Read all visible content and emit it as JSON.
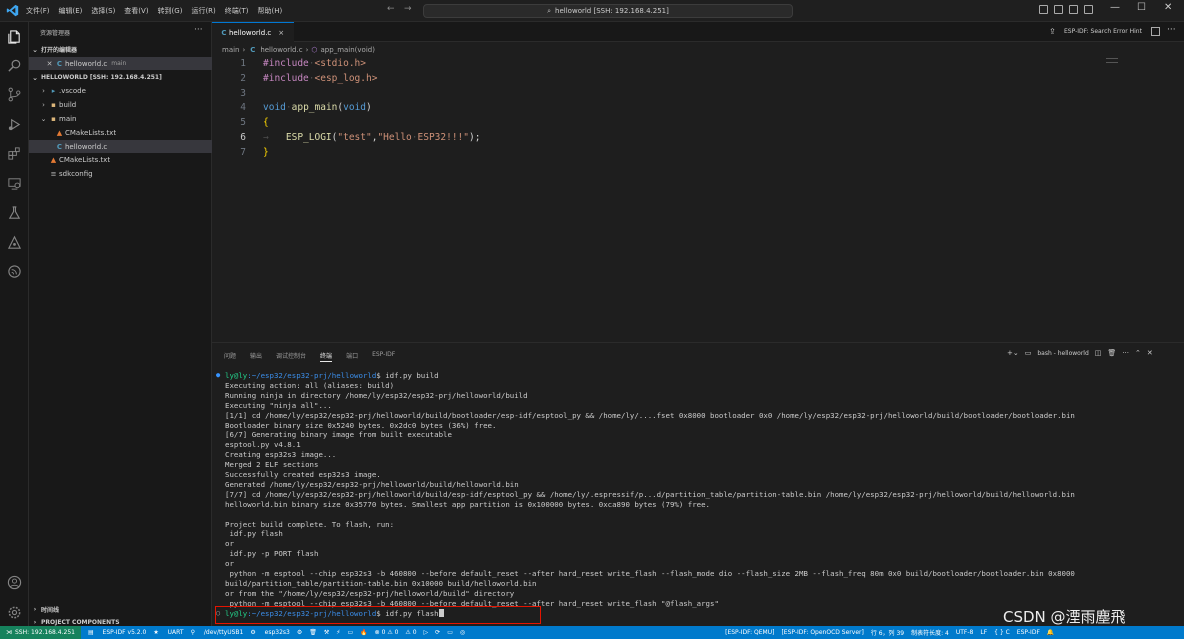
{
  "menu": [
    "文件(F)",
    "编辑(E)",
    "选择(S)",
    "查看(V)",
    "转到(G)",
    "运行(R)",
    "终端(T)",
    "帮助(H)"
  ],
  "search": {
    "text": "helloworld [SSH: 192.168.4.251]"
  },
  "window_controls": {
    "minimize": "—",
    "maximize": "☐",
    "close": "✕"
  },
  "sidebar": {
    "title": "资源管理器",
    "more": "···",
    "open_editors_label": "打开的编辑器",
    "open_editor": {
      "name": "helloworld.c",
      "tag": "main"
    },
    "workspace_label": "HELLOWORLD [SSH: 192.168.4.251]",
    "tree": [
      {
        "name": ".vscode",
        "kind": "folder"
      },
      {
        "name": "build",
        "kind": "folder"
      },
      {
        "name": "main",
        "kind": "folder-open"
      },
      {
        "name": "CMakeLists.txt",
        "kind": "cmake"
      },
      {
        "name": "helloworld.c",
        "kind": "c"
      },
      {
        "name": "CMakeLists.txt",
        "kind": "cmake"
      },
      {
        "name": "sdkconfig",
        "kind": "config"
      }
    ],
    "outline_label": "时间线",
    "components_label": "PROJECT COMPONENTS"
  },
  "tab": {
    "name": "helloworld.c",
    "close": "×"
  },
  "hint": "ESP-IDF: Search Error Hint",
  "breadcrumb": [
    "main",
    "helloworld.c",
    "app_main(void)"
  ],
  "code": {
    "line_numbers": [
      "1",
      "2",
      "3",
      "4",
      "5",
      "6",
      "7"
    ],
    "current_line": 6
  },
  "panel": {
    "tabs": [
      "问题",
      "输出",
      "调试控制台",
      "终端",
      "端口",
      "ESP-IDF"
    ],
    "active_tab": "终端",
    "shell": "bash - helloworld"
  },
  "terminal": {
    "prompt1_user": "ly@ly",
    "prompt1_path": ":~/esp32/esp32-prj/helloworld",
    "prompt1_cmd": "$ idf.py build",
    "lines": [
      "Executing action: all (aliases: build)",
      "Running ninja in directory /home/ly/esp32/esp32-prj/helloworld/build",
      "Executing \"ninja all\"...",
      "[1/1] cd /home/ly/esp32/esp32-prj/helloworld/build/bootloader/esp-idf/esptool_py && /home/ly/....fset 0x8000 bootloader 0x0 /home/ly/esp32/esp32-prj/helloworld/build/bootloader/bootloader.bin",
      "Bootloader binary size 0x5240 bytes. 0x2dc0 bytes (36%) free.",
      "[6/7] Generating binary image from built executable",
      "esptool.py v4.8.1",
      "Creating esp32s3 image...",
      "Merged 2 ELF sections",
      "Successfully created esp32s3 image.",
      "Generated /home/ly/esp32/esp32-prj/helloworld/build/helloworld.bin",
      "[7/7] cd /home/ly/esp32/esp32-prj/helloworld/build/esp-idf/esptool_py && /home/ly/.espressif/p...d/partition_table/partition-table.bin /home/ly/esp32/esp32-prj/helloworld/build/helloworld.bin",
      "helloworld.bin binary size 0x35770 bytes. Smallest app partition is 0x100000 bytes. 0xca890 bytes (79%) free.",
      "",
      "Project build complete. To flash, run:",
      " idf.py flash",
      "or",
      " idf.py -p PORT flash",
      "or",
      " python -m esptool --chip esp32s3 -b 460800 --before default_reset --after hard_reset write_flash --flash_mode dio --flash_size 2MB --flash_freq 80m 0x0 build/bootloader/bootloader.bin 0x8000",
      "build/partition_table/partition-table.bin 0x10000 build/helloworld.bin",
      "or from the \"/home/ly/esp32/esp32-prj/helloworld/build\" directory",
      " python -m esptool --chip esp32s3 -b 460800 --before default_reset --after hard_reset write_flash \"@flash_args\""
    ],
    "prompt2_user": "ly@ly",
    "prompt2_path": ":~/esp32/esp32-prj/helloworld",
    "prompt2_cmd": "$ idf.py flash"
  },
  "statusbar": {
    "remote": "SSH: 192.168.4.251",
    "idf_version": "ESP-IDF v5.2.0",
    "uart": "UART",
    "port": "/dev/ttyUSB1",
    "target": "esp32s3",
    "problems": "⊗ 0 ⚠ 0",
    "warnings": "⚠ 0",
    "qemu": "[ESP-IDF: QEMU]",
    "openocd": "[ESP-IDF: OpenOCD Server]",
    "position": "行 6，列 39",
    "indent": "制表符长度: 4",
    "encoding": "UTF-8",
    "eol": "LF",
    "language": "{ } C",
    "idf": "ESP-IDF"
  },
  "watermark": "CSDN @湮雨塵飛",
  "colors": {
    "accent": "#007acc",
    "remote": "#16825d",
    "highlight_box": "#e51400",
    "prompt": "#23d18b",
    "path": "#3b8eea"
  }
}
